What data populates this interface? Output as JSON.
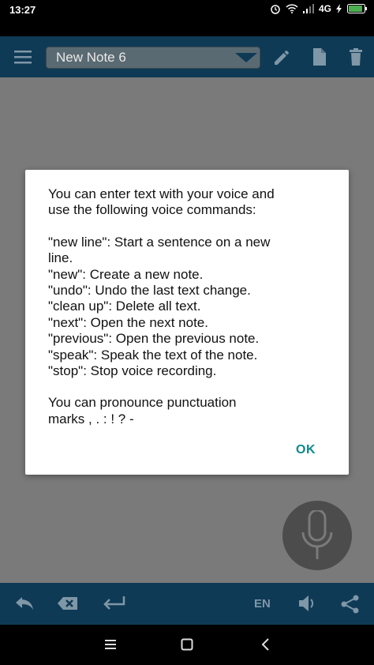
{
  "status_bar": {
    "time": "13:27",
    "network": "4G"
  },
  "toolbar": {
    "note_title": "New Note 6"
  },
  "dialog": {
    "intro": [
      "You can enter text with your voice and",
      "use the following voice commands:"
    ],
    "commands": [
      "\"new line\": Start a sentence on a new",
      "line.",
      "\"new\": Create a new note.",
      "\"undo\": Undo the last text change.",
      "\"clean up\": Delete all text.",
      "\"next\": Open the next note.",
      "\"previous\": Open the previous note.",
      "\"speak\": Speak the text of the note.",
      "\"stop\": Stop voice recording."
    ],
    "outro": [
      "You can pronounce punctuation",
      "marks , . : ! ? -"
    ],
    "ok_label": "OK"
  },
  "bottom_toolbar": {
    "language": "EN"
  },
  "colors": {
    "toolbar_bg": "#0f3a56",
    "accent_ok": "#0a8a8a",
    "scrim": "#7a7a7a"
  }
}
